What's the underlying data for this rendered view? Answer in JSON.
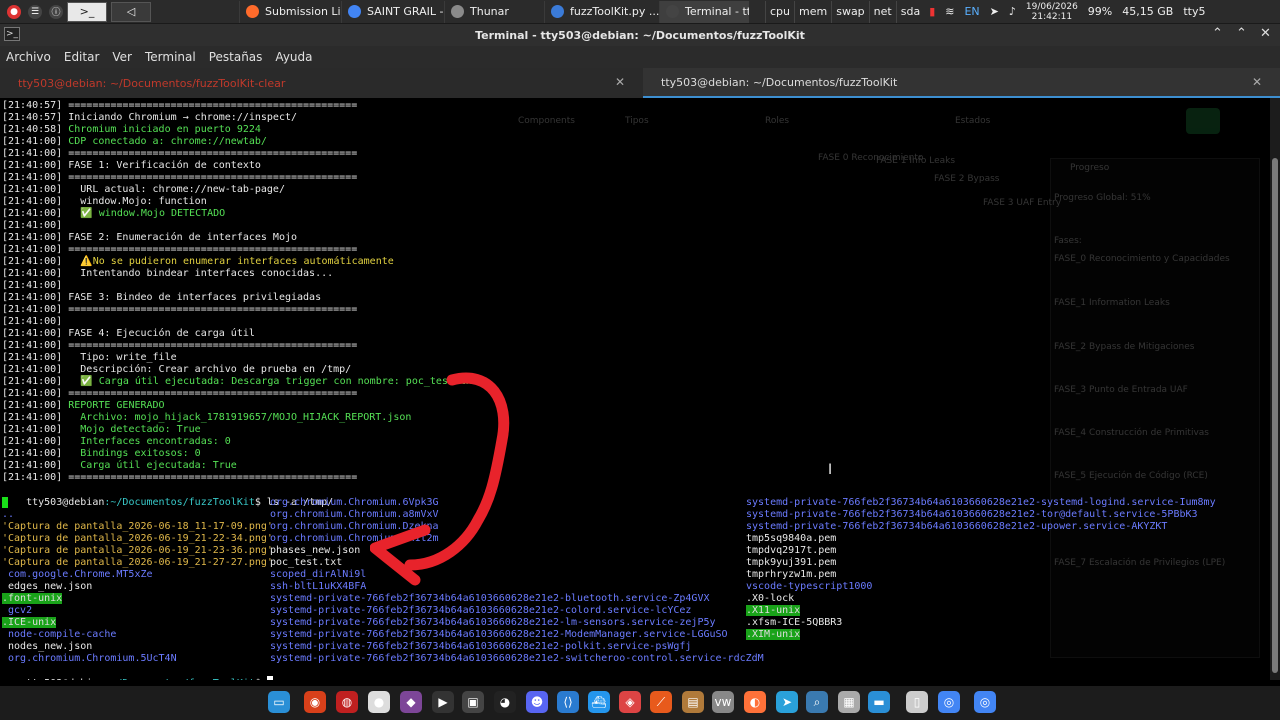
{
  "top_panel": {
    "tasks": [
      {
        "label": "Submission Li...",
        "color": "#ff6b2b"
      },
      {
        "label": "SAINT GRAIL -...",
        "color": "#4285f4"
      },
      {
        "label": "Thunar",
        "color": "#8a8a8a"
      },
      {
        "label": "fuzzToolKit.py ...",
        "color": "#3b7bd8"
      },
      {
        "label": "Terminal - tty5...",
        "color": "#444"
      }
    ],
    "monitors": [
      "cpu",
      "mem",
      "swap",
      "net",
      "sda"
    ],
    "lang": "EN",
    "date": "19/06/2026",
    "time": "21:42:11",
    "battery": "99%",
    "disk": "45,15 GB",
    "user": "tty5"
  },
  "window": {
    "title": "Terminal - tty503@debian: ~/Documentos/fuzzToolKit"
  },
  "menu": [
    "Archivo",
    "Editar",
    "Ver",
    "Terminal",
    "Pestañas",
    "Ayuda"
  ],
  "tabs": [
    {
      "label": "tty503@debian: ~/Documentos/fuzzToolKit-clear"
    },
    {
      "label": "tty503@debian: ~/Documentos/fuzzToolKit"
    }
  ],
  "log_lines": [
    {
      "ts": "[21:40:57]",
      "text": " ================================================",
      "cls": "w"
    },
    {
      "ts": "[21:40:57]",
      "text": " Iniciando Chromium → chrome://inspect/",
      "cls": "w"
    },
    {
      "ts": "[21:40:58]",
      "text": " Chromium iniciado en puerto 9224",
      "cls": "g"
    },
    {
      "ts": "[21:41:00]",
      "text": " CDP conectado a: chrome://newtab/",
      "cls": "g"
    },
    {
      "ts": "[21:41:00]",
      "text": " ================================================",
      "cls": "w"
    },
    {
      "ts": "[21:41:00]",
      "text": " FASE 1: Verificación de contexto",
      "cls": "w"
    },
    {
      "ts": "[21:41:00]",
      "text": " ================================================",
      "cls": "w"
    },
    {
      "ts": "[21:41:00]",
      "text": "   URL actual: chrome://new-tab-page/",
      "cls": "w"
    },
    {
      "ts": "[21:41:00]",
      "text": "   window.Mojo: function",
      "cls": "w"
    },
    {
      "ts": "[21:41:00]",
      "text": "   ✅ window.Mojo DETECTADO",
      "cls": "g"
    },
    {
      "ts": "[21:41:00]",
      "text": "",
      "cls": "w"
    },
    {
      "ts": "[21:41:00]",
      "text": " FASE 2: Enumeración de interfaces Mojo",
      "cls": "w"
    },
    {
      "ts": "[21:41:00]",
      "text": " ================================================",
      "cls": "w"
    },
    {
      "ts": "[21:41:00]",
      "text": "   ⚠️No se pudieron enumerar interfaces automáticamente",
      "cls": "y"
    },
    {
      "ts": "[21:41:00]",
      "text": "   Intentando bindear interfaces conocidas...",
      "cls": "w"
    },
    {
      "ts": "[21:41:00]",
      "text": "",
      "cls": "w"
    },
    {
      "ts": "[21:41:00]",
      "text": " FASE 3: Bindeo de interfaces privilegiadas",
      "cls": "w"
    },
    {
      "ts": "[21:41:00]",
      "text": " ================================================",
      "cls": "w"
    },
    {
      "ts": "[21:41:00]",
      "text": "",
      "cls": "w"
    },
    {
      "ts": "[21:41:00]",
      "text": " FASE 4: Ejecución de carga útil",
      "cls": "w"
    },
    {
      "ts": "[21:41:00]",
      "text": " ================================================",
      "cls": "w"
    },
    {
      "ts": "[21:41:00]",
      "text": "   Tipo: write_file",
      "cls": "w"
    },
    {
      "ts": "[21:41:00]",
      "text": "   Descripción: Crear archivo de prueba en /tmp/",
      "cls": "w"
    },
    {
      "ts": "[21:41:00]",
      "text": "   ✅ Carga útil ejecutada: Descarga trigger con nombre: poc_test.txt",
      "cls": "g"
    },
    {
      "ts": "[21:41:00]",
      "text": " ================================================",
      "cls": "w"
    },
    {
      "ts": "[21:41:00]",
      "text": " REPORTE GENERADO",
      "cls": "g"
    },
    {
      "ts": "[21:41:00]",
      "text": "   Archivo: mojo_hijack_1781919657/MOJO_HIJACK_REPORT.json",
      "cls": "g"
    },
    {
      "ts": "[21:41:00]",
      "text": "   Mojo detectado: True",
      "cls": "g"
    },
    {
      "ts": "[21:41:00]",
      "text": "   Interfaces encontradas: 0",
      "cls": "g"
    },
    {
      "ts": "[21:41:00]",
      "text": "   Bindings exitosos: 0",
      "cls": "g"
    },
    {
      "ts": "[21:41:00]",
      "text": "   Carga útil ejecutada: True",
      "cls": "g"
    },
    {
      "ts": "[21:41:00]",
      "text": " ================================================",
      "cls": "w"
    }
  ],
  "prompt": {
    "user": "tty503@debian",
    "path": ":~/Documentos/fuzzToolKit",
    "command": "$ ls -a /tmp/",
    "final_prompt": "$ "
  },
  "ls_col1": [
    {
      "t": ".",
      "k": "cur"
    },
    {
      "t": "..",
      "k": "b"
    },
    {
      "t": "'Captura de pantalla_2026-06-18_11-17-09.png'",
      "k": "q"
    },
    {
      "t": "'Captura de pantalla_2026-06-19_21-22-34.png'",
      "k": "q"
    },
    {
      "t": "'Captura de pantalla_2026-06-19_21-23-36.png'",
      "k": "q"
    },
    {
      "t": "'Captura de pantalla_2026-06-19_21-27-27.png'",
      "k": "q"
    },
    {
      "t": " com.google.Chrome.MT5xZe",
      "k": "b"
    },
    {
      "t": " edges_new.json",
      "k": "w"
    },
    {
      "t": ".font-unix",
      "k": "hl"
    },
    {
      "t": " gcv2",
      "k": "b"
    },
    {
      "t": ".ICE-unix",
      "k": "hl"
    },
    {
      "t": " node-compile-cache",
      "k": "b"
    },
    {
      "t": " nodes_new.json",
      "k": "w"
    },
    {
      "t": " org.chromium.Chromium.5UcT4N",
      "k": "b"
    }
  ],
  "ls_col2": [
    {
      "t": "org.chromium.Chromium.6Vpk3G",
      "k": "b"
    },
    {
      "t": "org.chromium.Chromium.a8mVxV",
      "k": "b"
    },
    {
      "t": "org.chromium.Chromium.Dzekna",
      "k": "b"
    },
    {
      "t": "org.chromium.Chromium.9x1t2m",
      "k": "b"
    },
    {
      "t": "phases_new.json",
      "k": "w"
    },
    {
      "t": "poc_test.txt",
      "k": "w"
    },
    {
      "t": "scoped_dirAlNi9l",
      "k": "b"
    },
    {
      "t": "ssh-bltL1uKX4BFA",
      "k": "b"
    },
    {
      "t": "systemd-private-766feb2f36734b64a6103660628e21e2-bluetooth.service-Zp4GVX",
      "k": "b"
    },
    {
      "t": "systemd-private-766feb2f36734b64a6103660628e21e2-colord.service-lcYCez",
      "k": "b"
    },
    {
      "t": "systemd-private-766feb2f36734b64a6103660628e21e2-lm-sensors.service-zejP5y",
      "k": "b"
    },
    {
      "t": "systemd-private-766feb2f36734b64a6103660628e21e2-ModemManager.service-LGGuSO",
      "k": "b"
    },
    {
      "t": "systemd-private-766feb2f36734b64a6103660628e21e2-polkit.service-psWgfj",
      "k": "b"
    },
    {
      "t": "systemd-private-766feb2f36734b64a6103660628e21e2-switcheroo-control.service-rdcZdM",
      "k": "b"
    }
  ],
  "ls_col3": [
    {
      "t": "systemd-private-766feb2f36734b64a6103660628e21e2-systemd-logind.service-Ium8my",
      "k": "b"
    },
    {
      "t": "systemd-private-766feb2f36734b64a6103660628e21e2-tor@default.service-5PBbK3",
      "k": "b"
    },
    {
      "t": "systemd-private-766feb2f36734b64a6103660628e21e2-upower.service-AKYZKT",
      "k": "b"
    },
    {
      "t": "tmp5sq9840a.pem",
      "k": "w"
    },
    {
      "t": "tmpdvq2917t.pem",
      "k": "w"
    },
    {
      "t": "tmpk9yuj391.pem",
      "k": "w"
    },
    {
      "t": "tmprhryzw1m.pem",
      "k": "w"
    },
    {
      "t": "vscode-typescript1000",
      "k": "b"
    },
    {
      "t": ".X0-lock",
      "k": "w"
    },
    {
      "t": ".X11-unix",
      "k": "hl"
    },
    {
      "t": ".xfsm-ICE-5QBBR3",
      "k": "w"
    },
    {
      "t": ".XIM-unix",
      "k": "hl"
    }
  ],
  "ghost_labels": [
    "Components",
    "Tipos",
    "Roles",
    "Estados",
    "FASE 0 Reconocimiento",
    "FASE 1 Info Leaks",
    "FASE 2 Bypass",
    "FASE 3 UAF Entry",
    "Progreso",
    "Progreso Global: 51%",
    "Fases:",
    "FASE_0 Reconocimiento y Capacidades",
    "FASE_1 Information Leaks",
    "FASE_2 Bypass de Mitigaciones",
    "FASE_3 Punto de Entrada UAF",
    "FASE_4 Construcción de Primitivas",
    "FASE_5 Ejecución de Código (RCE)",
    "FASE_7 Escalación de Privilegios (LPE)"
  ],
  "dock_apps": [
    {
      "name": "show-desktop-icon",
      "color": "#2a8fd6"
    },
    {
      "name": "app-red-icon",
      "color": "#d8401a"
    },
    {
      "name": "app-spiral-icon",
      "color": "#c02020"
    },
    {
      "name": "app-disc-icon",
      "color": "#dddddd"
    },
    {
      "name": "tor-browser-icon",
      "color": "#7d4698"
    },
    {
      "name": "terminal-icon",
      "color": "#333333"
    },
    {
      "name": "app-dark-icon",
      "color": "#444444"
    },
    {
      "name": "github-icon",
      "color": "#222222"
    },
    {
      "name": "discord-icon",
      "color": "#5865f2"
    },
    {
      "name": "vscode-icon",
      "color": "#2a7bd0"
    },
    {
      "name": "docker-icon",
      "color": "#2496ed"
    },
    {
      "name": "chromium-alt-icon",
      "color": "#d44"
    },
    {
      "name": "burp-icon",
      "color": "#e85a1c"
    },
    {
      "name": "app-brown-icon",
      "color": "#b07a3a"
    },
    {
      "name": "vmware-icon",
      "color": "#888"
    },
    {
      "name": "firefox-icon",
      "color": "#ff7139"
    },
    {
      "name": "telegram-icon",
      "color": "#2aa1da"
    },
    {
      "name": "search-tool-icon",
      "color": "#3a7ab0"
    },
    {
      "name": "app-grid-icon",
      "color": "#aaa"
    },
    {
      "name": "files-icon",
      "color": "#2a8fd6"
    },
    {
      "name": "clipboard-icon",
      "color": "#ccc"
    },
    {
      "name": "chrome-icon",
      "color": "#4285f4"
    },
    {
      "name": "chrome-2-icon",
      "color": "#4285f4"
    }
  ],
  "dock_glyphs": [
    "▭",
    "◉",
    "◍",
    "●",
    "◆",
    "▶",
    "▣",
    "◕",
    "☻",
    "⟨⟩",
    "⛴",
    "◈",
    "⟋",
    "▤",
    "vw",
    "◐",
    "➤",
    "⌕",
    "▦",
    "▬",
    "▯",
    "◎",
    "◎"
  ],
  "dock_positions": [
    268,
    304,
    336,
    368,
    400,
    432,
    462,
    494,
    526,
    557,
    588,
    619,
    650,
    682,
    712,
    744,
    776,
    806,
    838,
    868,
    906,
    938,
    974,
    1006
  ]
}
